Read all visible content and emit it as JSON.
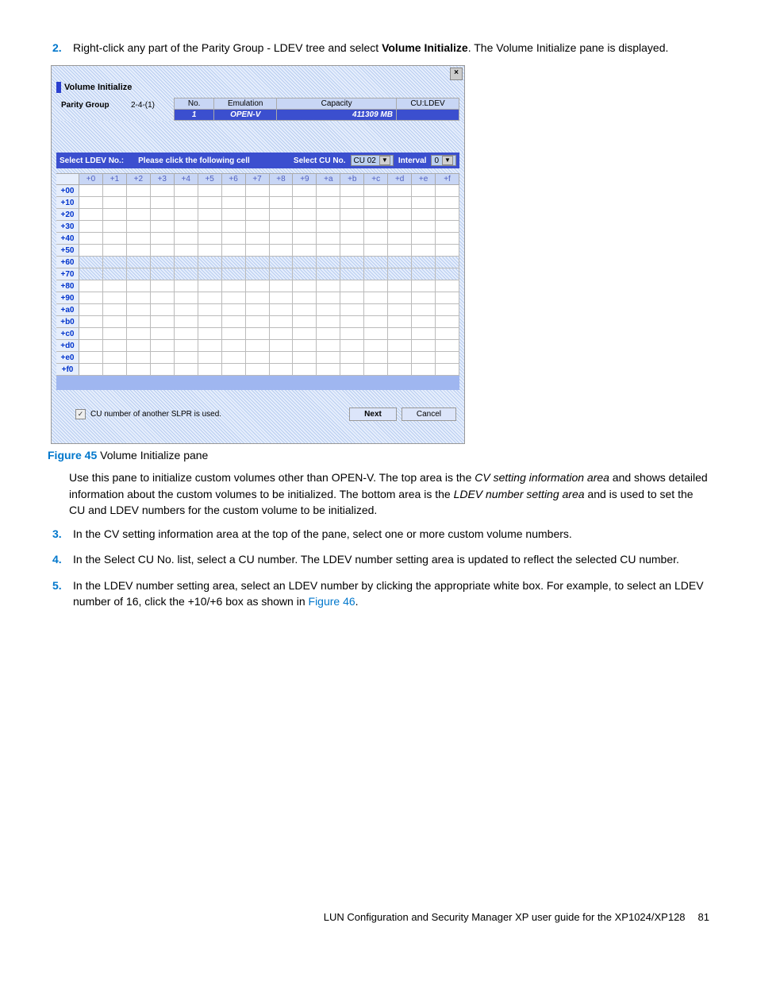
{
  "steps": {
    "s2_pre": "Right-click any part of the Parity Group - LDEV tree and select ",
    "s2_bold": "Volume Initialize",
    "s2_post": ". The Volume Initialize pane is displayed.",
    "s3": "In the CV setting information area at the top of the pane, select one or more custom volume numbers.",
    "s4": "In the Select CU No. list, select a CU number. The LDEV number setting area is updated to reflect the selected CU number.",
    "s5_pre": "In the LDEV number setting area, select an LDEV number by clicking the appropriate white box. For example, to select an LDEV number of 16, click the +10/+6 box as shown in ",
    "s5_link": "Figure 46",
    "s5_post": "."
  },
  "figure": {
    "label": "Figure 45",
    "caption": "Volume Initialize pane"
  },
  "para": {
    "p1_pre": "Use this pane to initialize custom volumes other than OPEN-V. The top area is the ",
    "p1_i1": "CV setting information area",
    "p1_mid": " and shows detailed information about the custom volumes to be initialized. The bottom area is the ",
    "p1_i2": "LDEV number setting area",
    "p1_post": " and is used to set the CU and LDEV numbers for the custom volume to be initialized."
  },
  "screenshot": {
    "title": "Volume Initialize",
    "pg_label": "Parity Group",
    "pg_value": "2-4-(1)",
    "info_headers": {
      "no": "No.",
      "emu": "Emulation",
      "cap": "Capacity",
      "cl": "CU:LDEV"
    },
    "info_values": {
      "no": "1",
      "emu": "OPEN-V",
      "cap": "411309 MB",
      "cl": ""
    },
    "select_ldev": "Select LDEV No.:",
    "please_click": "Please click the following cell",
    "select_cu": "Select CU No.",
    "cu_val": "CU 02",
    "interval": "Interval",
    "interval_val": "0",
    "cols": [
      "+0",
      "+1",
      "+2",
      "+3",
      "+4",
      "+5",
      "+6",
      "+7",
      "+8",
      "+9",
      "+a",
      "+b",
      "+c",
      "+d",
      "+e",
      "+f"
    ],
    "rows": [
      "+00",
      "+10",
      "+20",
      "+30",
      "+40",
      "+50",
      "+60",
      "+70",
      "+80",
      "+90",
      "+a0",
      "+b0",
      "+c0",
      "+d0",
      "+e0",
      "+f0"
    ],
    "hatch_rows": [
      "+60",
      "+70"
    ],
    "checkbox_label": "CU number of another SLPR is used.",
    "next": "Next",
    "cancel": "Cancel"
  },
  "footer": {
    "text": "LUN Configuration and Security Manager XP user guide for the XP1024/XP128",
    "page": "81"
  }
}
